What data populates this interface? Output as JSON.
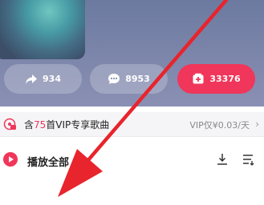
{
  "actions": {
    "share_count": "934",
    "comment_count": "8953",
    "collect_count": "33376"
  },
  "vip": {
    "prefix": "含",
    "count": "75",
    "suffix": "首VIP专享歌曲",
    "price": "VIP仅¥0.03/天",
    "chevron": "›"
  },
  "playbar": {
    "label": "播放全部",
    "count": "(",
    "icons": [
      "play-icon",
      "download-icon",
      "sort-icon"
    ]
  },
  "colors": {
    "accent": "#f0365a",
    "hero": "#7d86ab"
  }
}
